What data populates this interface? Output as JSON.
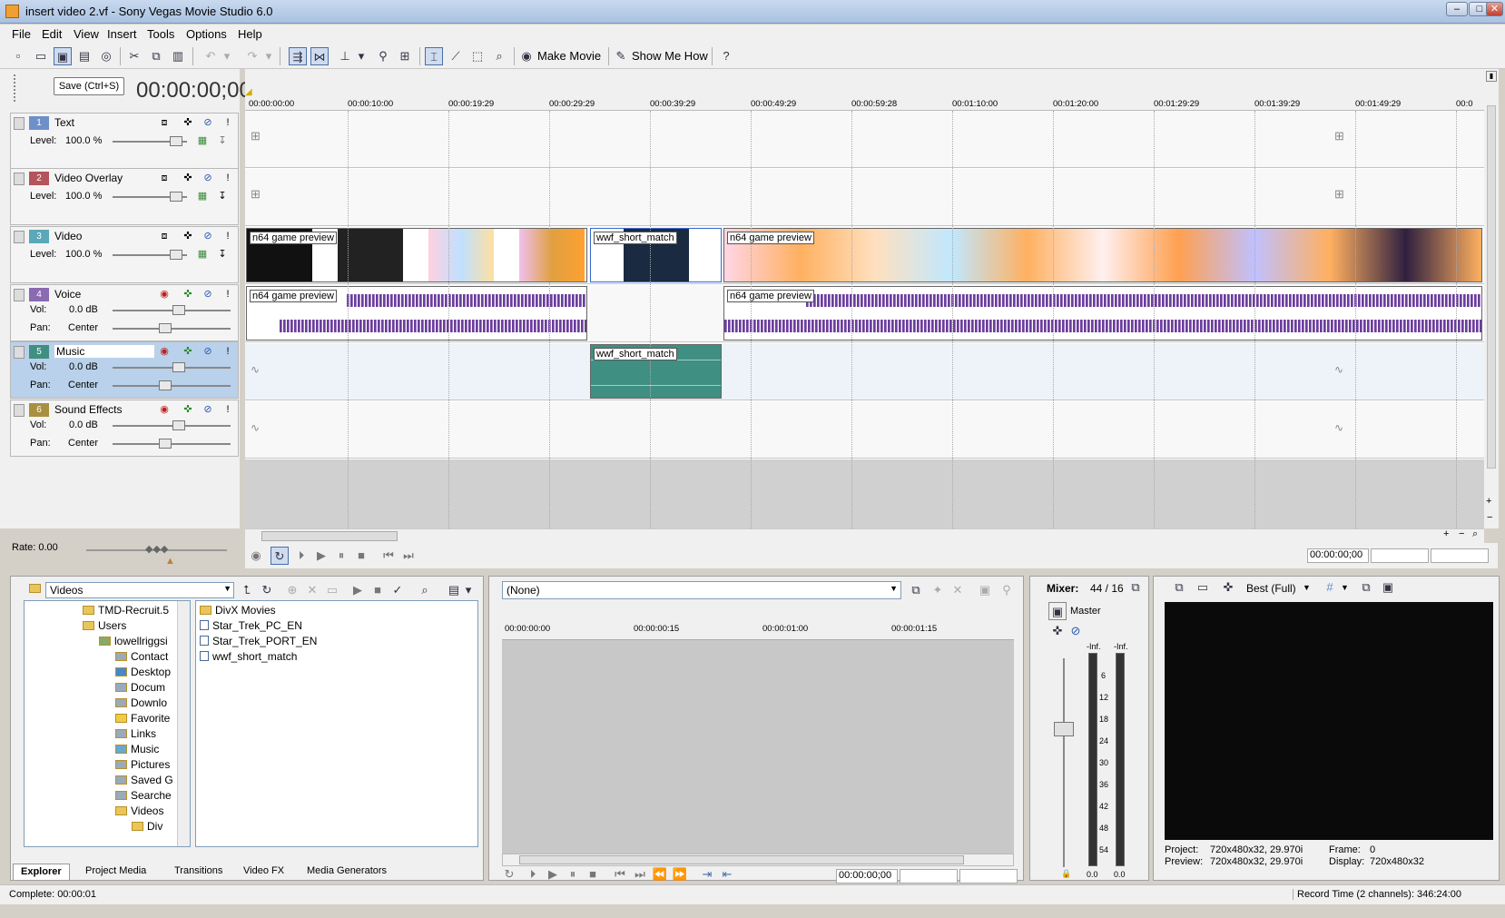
{
  "window": {
    "title": "insert video 2.vf - Sony Vegas Movie Studio 6.0",
    "min": "–",
    "max": "□",
    "close": "✕"
  },
  "menu": [
    "File",
    "Edit",
    "View",
    "Insert",
    "Tools",
    "Options",
    "Help"
  ],
  "toolbar": {
    "make_movie": "Make Movie",
    "show_me_how": "Show Me How"
  },
  "tooltip": "Save (Ctrl+S)",
  "timecode": "00:00:00;00",
  "tracks": [
    {
      "num": "1",
      "name": "Text",
      "color": "#6f8fc9",
      "row1_label": "Level:",
      "row1_value": "100.0 %"
    },
    {
      "num": "2",
      "name": "Video Overlay",
      "color": "#b5545c",
      "row1_label": "Level:",
      "row1_value": "100.0 %"
    },
    {
      "num": "3",
      "name": "Video",
      "color": "#5aa8b8",
      "row1_label": "Level:",
      "row1_value": "100.0 %"
    },
    {
      "num": "4",
      "name": "Voice",
      "color": "#8a6ab0",
      "row1_label": "Vol:",
      "row1_value": "0.0 dB",
      "row2_label": "Pan:",
      "row2_value": "Center"
    },
    {
      "num": "5",
      "name": "Music",
      "color": "#3f8f82",
      "row1_label": "Vol:",
      "row1_value": "0.0 dB",
      "row2_label": "Pan:",
      "row2_value": "Center"
    },
    {
      "num": "6",
      "name": "Sound Effects",
      "color": "#a89040",
      "row1_label": "Vol:",
      "row1_value": "0.0 dB",
      "row2_label": "Pan:",
      "row2_value": "Center"
    }
  ],
  "ruler_ticks": [
    "00:00:00:00",
    "00:00:10:00",
    "00:00:19:29",
    "00:00:29:29",
    "00:00:39:29",
    "00:00:49:29",
    "00:00:59:28",
    "00:01:10:00",
    "00:01:20:00",
    "00:01:29:29",
    "00:01:39:29",
    "00:01:49:29",
    "00:0"
  ],
  "events": {
    "n64_a": "n64 game preview",
    "wwf_v": "wwf_short_match",
    "n64_b": "n64 game preview",
    "n64_audio_a": "n64 game preview",
    "n64_audio_b": "n64 game preview",
    "wwf_a": "wwf_short_match"
  },
  "rate": "Rate: 0.00",
  "transport_time": "00:00:00;00",
  "explorer": {
    "path": "Videos",
    "tree": [
      "TMD-Recruit.5",
      "Users",
      "lowellriggsi",
      "Contact",
      "Desktop",
      "Docum",
      "Downlo",
      "Favorite",
      "Links",
      "Music",
      "Pictures",
      "Saved G",
      "Searche",
      "Videos",
      "Div"
    ],
    "files": [
      "DivX Movies",
      "Star_Trek_PC_EN",
      "Star_Trek_PORT_EN",
      "wwf_short_match"
    ]
  },
  "tabs": [
    "Explorer",
    "Project Media",
    "Transitions",
    "Video FX",
    "Media Generators"
  ],
  "trimmer": {
    "selection": "(None)",
    "ticks": [
      "00:00:00:00",
      "00:00:00:15",
      "00:00:01:00",
      "00:00:01:15"
    ],
    "time": "00:00:00;00"
  },
  "mixer": {
    "title": "Mixer:",
    "value": "44 / 16",
    "master": "Master",
    "inf_l": "-Inf.",
    "inf_r": "-Inf.",
    "scale": [
      "6",
      "12",
      "18",
      "24",
      "30",
      "36",
      "42",
      "48",
      "54"
    ],
    "bottom_l": "0.0",
    "bottom_r": "0.0"
  },
  "preview": {
    "quality": "Best (Full)",
    "project_label": "Project:",
    "project": "720x480x32, 29.970i",
    "preview_label": "Preview:",
    "preview": "720x480x32, 29.970i",
    "frame_label": "Frame:",
    "frame": "0",
    "display_label": "Display:",
    "display": "720x480x32"
  },
  "status": {
    "left": "Complete: 00:00:01",
    "right": "Record Time (2 channels): 346:24:00"
  }
}
